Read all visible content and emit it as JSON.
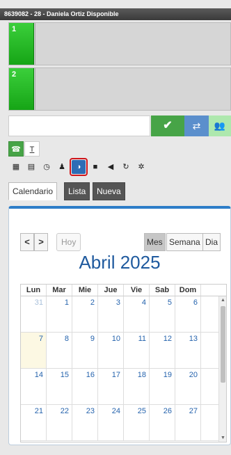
{
  "title": "8639082 - 28 - Daniela Ortiz Disponible",
  "lines": [
    {
      "label": "1"
    },
    {
      "label": "2"
    }
  ],
  "number_input": {
    "value": "",
    "placeholder": ""
  },
  "action_buttons": {
    "call_icon": "check-icon",
    "transfer_icon": "transfer-icon",
    "conference_icon": "users-icon"
  },
  "modes": [
    {
      "icon": "phone-icon",
      "glyph": "☎"
    },
    {
      "icon": "text-icon",
      "glyph": "T"
    }
  ],
  "tools": [
    {
      "icon": "grid-icon",
      "glyph": "▦"
    },
    {
      "icon": "list-icon",
      "glyph": "▤"
    },
    {
      "icon": "clock-icon",
      "glyph": "◷"
    },
    {
      "icon": "user-icon",
      "glyph": "♟"
    },
    {
      "icon": "globe-icon",
      "glyph": "◑"
    },
    {
      "icon": "comment-icon",
      "glyph": "■"
    },
    {
      "icon": "bullhorn-icon",
      "glyph": "◀"
    },
    {
      "icon": "refresh-icon",
      "glyph": "↻"
    },
    {
      "icon": "gear-icon",
      "glyph": "✲"
    }
  ],
  "tabs": {
    "calendar": "Calendario",
    "list": "Lista",
    "new": "Nueva"
  },
  "calendar": {
    "nav_prev": "<",
    "nav_next": ">",
    "today": "Hoy",
    "views": {
      "month": "Mes",
      "week": "Semana",
      "day": "Dia"
    },
    "active_view": "Mes",
    "title": "Abril 2025",
    "weekdays": [
      "Lun",
      "Mar",
      "Mie",
      "Jue",
      "Vie",
      "Sab",
      "Dom"
    ],
    "weeks": [
      [
        "31",
        "1",
        "2",
        "3",
        "4",
        "5",
        "6"
      ],
      [
        "7",
        "8",
        "9",
        "10",
        "11",
        "12",
        "13"
      ],
      [
        "14",
        "15",
        "16",
        "17",
        "18",
        "19",
        "20"
      ],
      [
        "21",
        "22",
        "23",
        "24",
        "25",
        "26",
        "27"
      ]
    ],
    "today_date": "7",
    "colors": {
      "accent": "#2d7dc8",
      "day_number": "#2563ad",
      "today_bg": "#fcf8e3"
    }
  }
}
